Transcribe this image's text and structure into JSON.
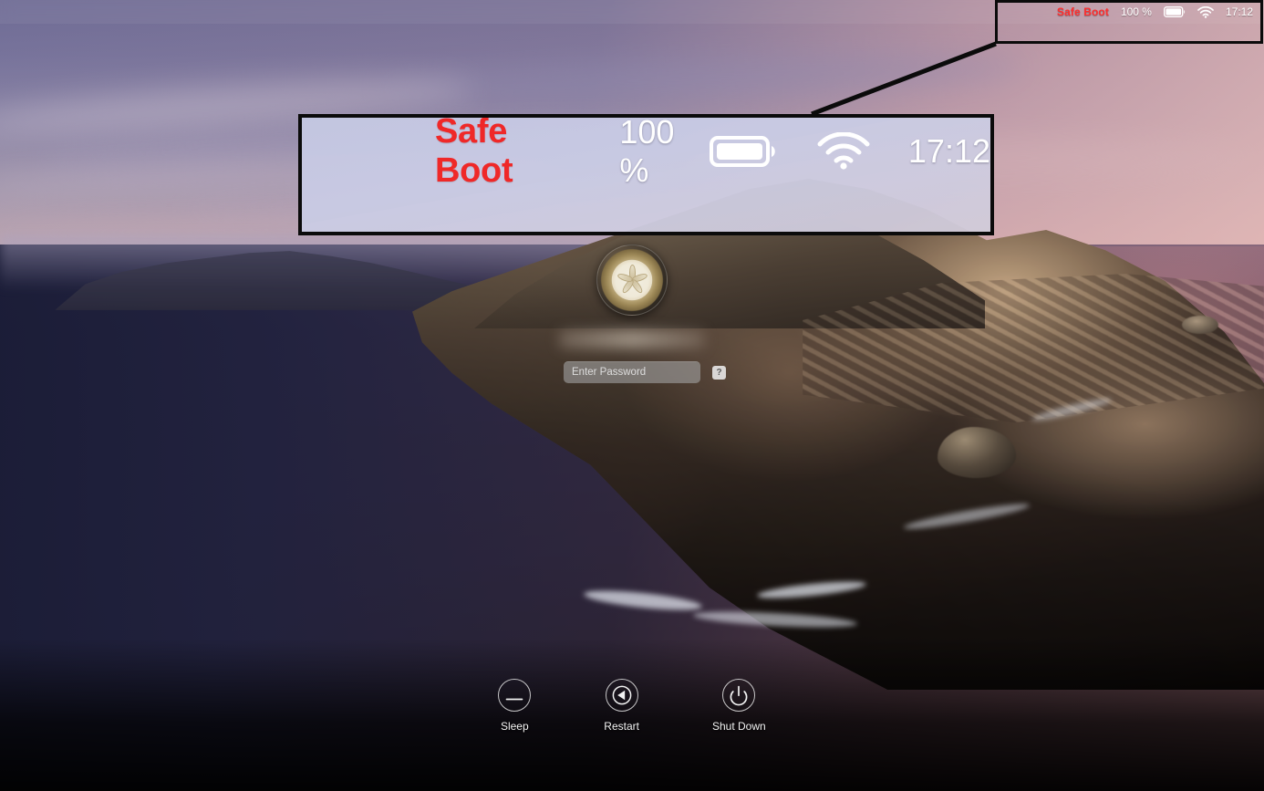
{
  "screen": {
    "name": "macos-login-window",
    "wallpaper_name": "catalina-coast-dusk"
  },
  "menubar": {
    "safe_boot_label": "Safe Boot",
    "battery_percent": "100 %",
    "battery_icon": "battery-full-icon",
    "wifi_icon": "wifi-icon",
    "clock": "17:12",
    "safe_boot_color": "#ff2d2d",
    "text_color": "#ffffff"
  },
  "callout": {
    "name": "menubar-zoom-callout",
    "safe_boot_label": "Safe Boot",
    "battery_percent": "100 %",
    "battery_icon": "battery-full-icon",
    "wifi_icon": "wifi-icon",
    "clock": "17:12",
    "safe_boot_color": "#ef2828",
    "border_color": "#0b0b0b"
  },
  "login": {
    "avatar_name": "sand-dollar-avatar",
    "username_display": "",
    "username_redacted": true,
    "password_placeholder": "Enter Password",
    "password_value": "",
    "hint_button_label": "?"
  },
  "power": {
    "buttons": [
      {
        "id": "sleep",
        "label": "Sleep",
        "icon": "sleep-icon"
      },
      {
        "id": "restart",
        "label": "Restart",
        "icon": "restart-icon"
      },
      {
        "id": "shutdown",
        "label": "Shut Down",
        "icon": "power-icon"
      }
    ]
  }
}
